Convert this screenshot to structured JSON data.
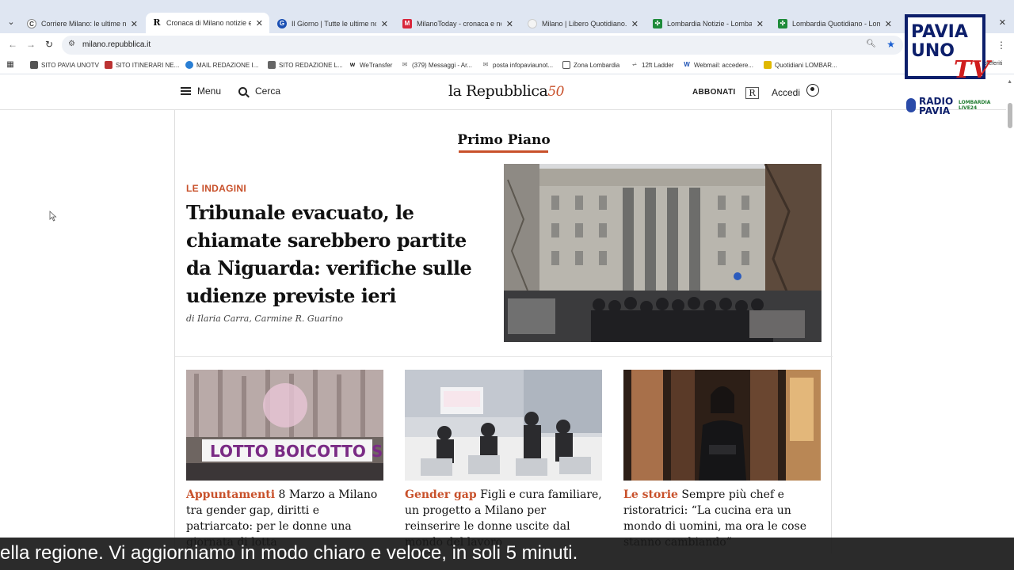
{
  "browser": {
    "tabs": [
      {
        "title": "Corriere Milano: le ultime news",
        "favicon": "corriere-icon",
        "color": "#ffffff"
      },
      {
        "title": "Cronaca di Milano notizie e agg",
        "favicon": "repubblica-icon",
        "color": "#ffffff"
      },
      {
        "title": "Il Giorno | Tutte le ultime notizi",
        "favicon": "ilgiorno-icon",
        "color": "#1a4fb3"
      },
      {
        "title": "MilanoToday - cronaca e notizie",
        "favicon": "milanotoday-icon",
        "color": "#d8263b"
      },
      {
        "title": "Milano | Libero Quotidiano.it",
        "favicon": "libero-icon",
        "color": "#ffffff"
      },
      {
        "title": "Lombardia Notizie - Lombardia",
        "favicon": "lombardia-icon",
        "color": "#1e8b3a"
      },
      {
        "title": "Lombardia Quotidiano - Lomb",
        "favicon": "lombardia-icon",
        "color": "#1e8b3a"
      }
    ],
    "url": "milano.repubblica.it",
    "bookmarks": [
      "SITO PAVIA UNOTV",
      "SITO ITINERARI NE...",
      "MAIL REDAZIONE I...",
      "SITO REDAZIONE L...",
      "WeTransfer",
      "(379) Messaggi - Ar...",
      "posta infopaviaunot...",
      "Zona Lombardia",
      "12ft Ladder",
      "Webmail: accedere...",
      "Quotidiani LOMBAR..."
    ],
    "bookmarks_overflow": "preferiti"
  },
  "header": {
    "menu_label": "Menu",
    "search_label": "Cerca",
    "logo_text": "la Repubblica",
    "logo_badge": "50",
    "subscribe_label": "ABBONATI",
    "r_badge": "R",
    "login_label": "Accedi"
  },
  "main": {
    "section_title": "Primo Piano",
    "lead": {
      "kicker": "LE INDAGINI",
      "headline": "Tribunale evacuato, le chiamate sarebbero partite da Niguarda: verifiche sulle udienze previste ieri",
      "byline": "di Ilaria Carra, Carmine R. Guarino"
    },
    "cards": [
      {
        "category": "Appuntamenti",
        "title": "8 Marzo a Milano tra gender gap, diritti e patriarcato: per le donne una giornata di lotta"
      },
      {
        "category": "Gender gap",
        "title": "Figli e cura familiare, un progetto a Milano per reinserire le donne uscite dal mondo del lavoro"
      },
      {
        "category": "Le storie",
        "title": "Sempre più chef e ristoratrici: “La cucina era un mondo di uomini, ma ora le cose stanno cambiando”"
      }
    ]
  },
  "overlay": {
    "logo_line1": "PAVIA",
    "logo_line2": "UNO",
    "logo_tv": "TV",
    "radio_line1": "RADIO",
    "radio_line2": "PAVIA",
    "live_badge": "LOMBARDIA LIVE24",
    "subtitle": "ella regione. Vi aggiorniamo in modo chiaro e veloce, in soli 5 minuti."
  },
  "colors": {
    "accent": "#c8502a",
    "tabstrip": "#dfe6f2",
    "subtitle_bg": "#191919"
  }
}
